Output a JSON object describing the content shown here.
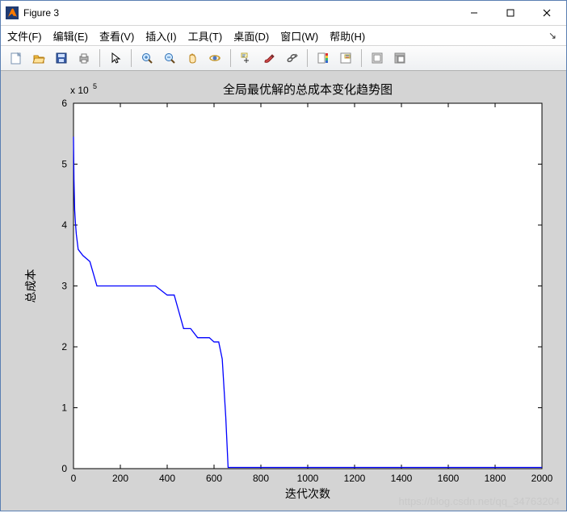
{
  "window": {
    "title": "Figure 3"
  },
  "menu": {
    "file": "文件(F)",
    "edit": "编辑(E)",
    "view": "查看(V)",
    "insert": "插入(I)",
    "tools": "工具(T)",
    "desktop": "桌面(D)",
    "window_": "窗口(W)",
    "help": "帮助(H)"
  },
  "toolbar": {
    "new": "New Figure",
    "open": "Open",
    "save": "Save",
    "print": "Print",
    "pointer": "Edit Plot",
    "zoomin": "Zoom In",
    "zoomout": "Zoom Out",
    "pan": "Pan",
    "rotate": "Rotate 3D",
    "datacursor": "Data Cursor",
    "brush": "Brush",
    "link": "Link Plot",
    "colorbar": "Insert Colorbar",
    "legend": "Insert Legend",
    "hideplot": "Hide Plot Tools",
    "showplot": "Show Plot Tools"
  },
  "chart_data": {
    "type": "line",
    "title": "全局最优解的总成本变化趋势图",
    "xlabel": "迭代次数",
    "ylabel": "总成本",
    "y_scale_label": "x 10",
    "y_scale_exp": "5",
    "xlim": [
      0,
      2000
    ],
    "ylim": [
      0,
      6
    ],
    "xticks": [
      0,
      200,
      400,
      600,
      800,
      1000,
      1200,
      1400,
      1600,
      1800,
      2000
    ],
    "yticks": [
      0,
      1,
      2,
      3,
      4,
      5,
      6
    ],
    "series": [
      {
        "name": "总成本",
        "x": [
          0,
          2,
          5,
          8,
          12,
          20,
          40,
          70,
          100,
          130,
          250,
          350,
          400,
          430,
          470,
          500,
          530,
          580,
          600,
          620,
          635,
          650,
          660,
          2000
        ],
        "y": [
          5.45,
          4.75,
          4.25,
          4.05,
          3.85,
          3.6,
          3.5,
          3.4,
          3.0,
          3.0,
          3.0,
          3.0,
          2.85,
          2.85,
          2.3,
          2.3,
          2.15,
          2.15,
          2.08,
          2.08,
          1.8,
          0.85,
          0.02,
          0.02
        ]
      }
    ]
  },
  "watermark": "https://blog.csdn.net/qq_34763204"
}
